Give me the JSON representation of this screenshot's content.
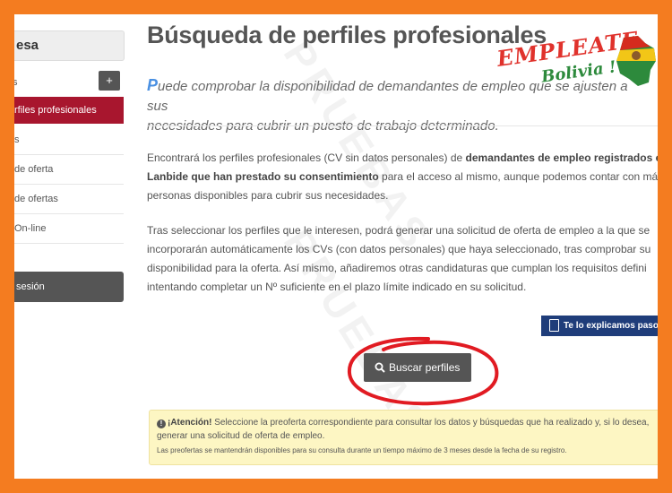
{
  "sidebar": {
    "header": "esa",
    "sub_label": "s",
    "add_label": "+",
    "active_item": "rfiles profesionales",
    "items": [
      "s",
      "de oferta",
      "de ofertas",
      "On-line"
    ],
    "logout": "sesión"
  },
  "main": {
    "title": "Búsqueda de perfiles profesionales",
    "lead_first": "P",
    "lead_rest1": "uede comprobar la disponibilidad de demandantes de empleo que se ajusten a sus",
    "lead_rest2": "necesidades para cubrir un puesto de trabajo determinado.",
    "p1_l1_a": "Encontrará los perfiles profesionales (CV sin datos personales) de ",
    "p1_l1_b": "demandantes de empleo registrados e",
    "p1_l2_a": "Lanbide que han prestado su consentimiento",
    "p1_l2_b": " para el acceso al mismo, aunque podemos contar con más",
    "p1_l3": "personas disponibles para cubrir sus necesidades.",
    "p2_l1": "Tras seleccionar los perfiles que le interesen, podrá generar una solicitud de oferta de empleo a la que se",
    "p2_l2": "incorporarán automáticamente los CVs (con datos personales) que haya seleccionado, tras comprobar su",
    "p2_l3": "disponibilidad para la oferta. Así mismo, añadiremos otras candidaturas que cumplan los requisitos defini",
    "p2_l4": "intentando completar un Nº suficiente en el plazo límite indicado en su solicitud.",
    "explain_button": "Te lo explicamos paso a",
    "search_button": "Buscar perfiles",
    "alert_strong": "¡Atención!",
    "alert_text": " Seleccione la preoferta correspondiente para consultar los datos y búsquedas que ha realizado y, si lo desea, generar una solicitud de oferta de empleo.",
    "alert_small": "Las preofertas se mantendrán disponibles para su consulta durante un tiempo máximo de 3 meses desde la fecha de su registro."
  },
  "watermark": "PRUEBAS",
  "logo": {
    "word1": "EMPLEATE",
    "word2": "Bolivia !"
  },
  "colors": {
    "border": "#f47c20",
    "active": "#a8162e",
    "button": "#555555",
    "accent": "#4a90e2",
    "circle": "#e11b22",
    "alert_bg": "#fdf6c3",
    "explain_bg": "#1f3d7a"
  }
}
